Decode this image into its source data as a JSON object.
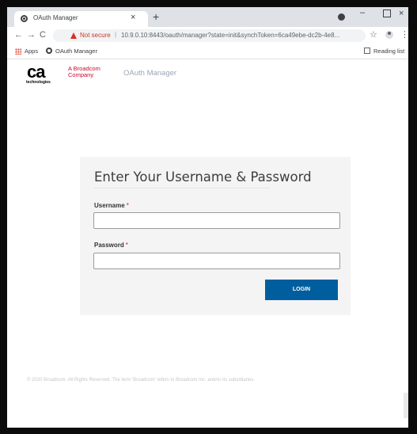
{
  "browser": {
    "tab_title": "OAuth Manager",
    "tab_close": "×",
    "new_tab": "+",
    "minimize": "–",
    "close": "×",
    "security": "Not secure",
    "url_separator": "|",
    "url": "10.9.0.10:8443/oauth/manager?state=init&synchToken=6ca49ebe-dc2b-4e8...",
    "back": "←",
    "forward": "→",
    "reload": "C",
    "star": "☆",
    "menu": "⋮"
  },
  "bookmarks": {
    "apps": "Apps",
    "oauth_manager": "OAuth Manager",
    "reading_list": "Reading list"
  },
  "header": {
    "logo_ca": "ca",
    "logo_technologies": "technologies",
    "logo_broadcom_1": "A Broadcom",
    "logo_broadcom_2": "Company",
    "app_name": "OAuth Manager"
  },
  "login": {
    "heading": "Enter Your Username & Password",
    "username_label": "Username",
    "password_label": "Password",
    "required_mark": "*",
    "username_value": "",
    "password_value": "",
    "button": "LOGIN"
  },
  "footer": {
    "text": "© 2020 Broadcom. All Rights Reserved. The term 'Broadcom' refers to Broadcom Inc. and/or its subsidiaries."
  },
  "colors": {
    "accent": "#005e9e",
    "brand_red": "#cc092f",
    "warning": "#d93025"
  }
}
